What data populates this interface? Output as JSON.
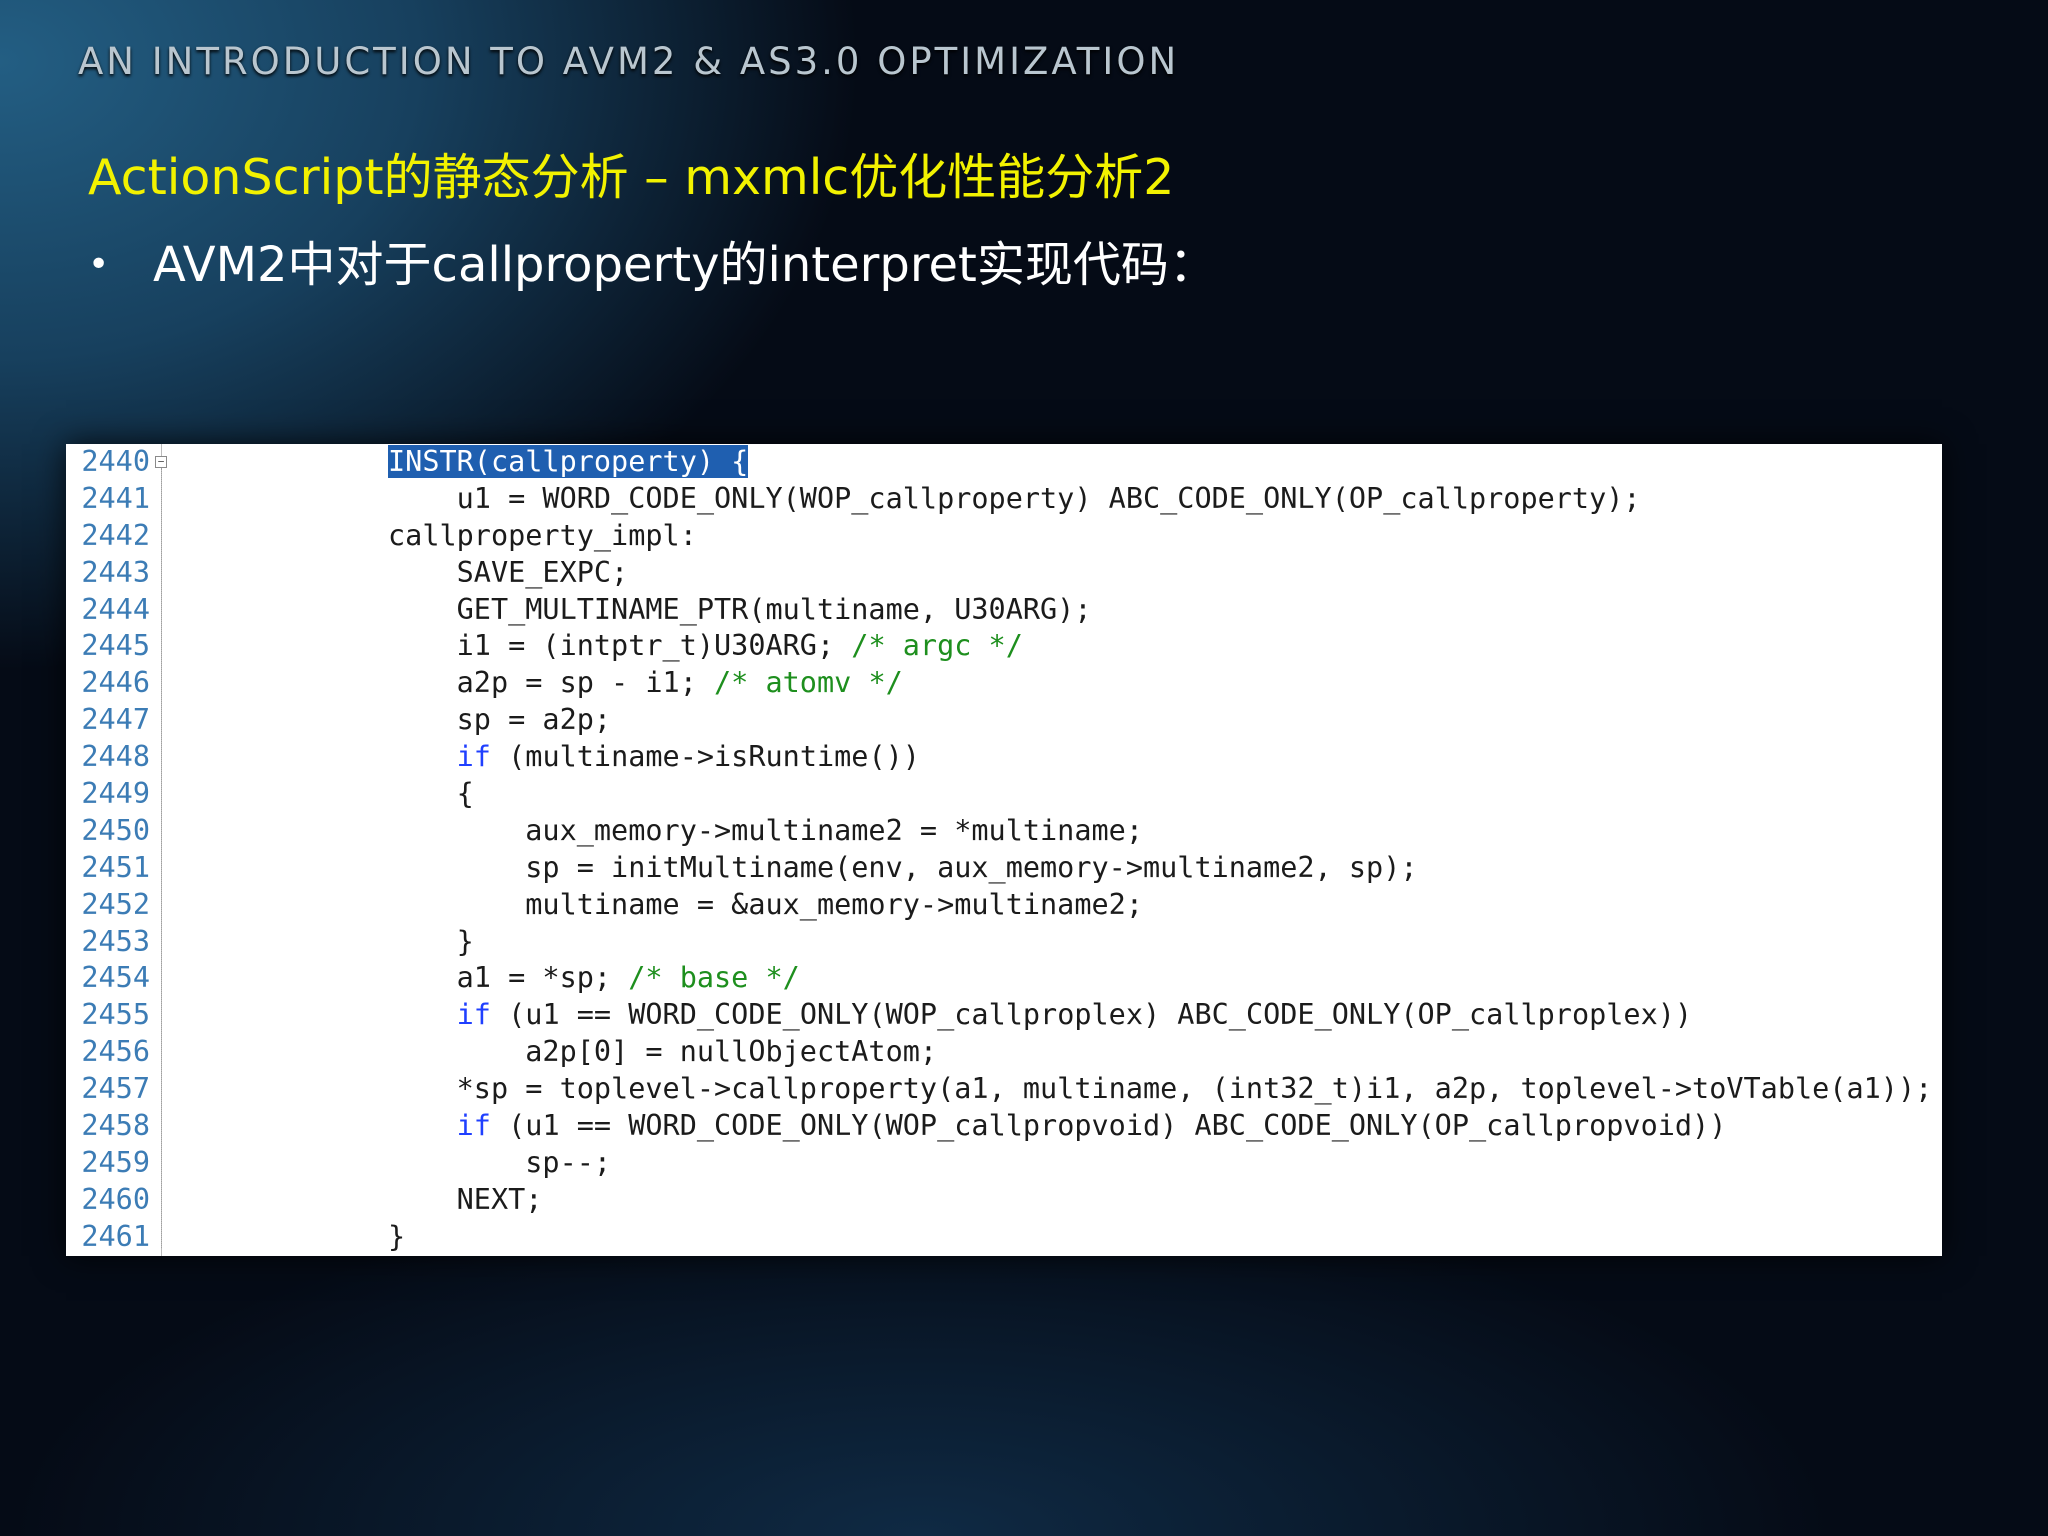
{
  "deck": {
    "title": "AN INTRODUCTION TO AVM2 & AS3.0 OPTIMIZATION"
  },
  "slide": {
    "heading": "ActionScript的静态分析 – mxmlc优化性能分析2",
    "bullet_mark": "•",
    "bullet": "AVM2中对于callproperty的interpret实现代码："
  },
  "code": {
    "fold_glyph": "−",
    "line_numbers": [
      "2440",
      "2441",
      "2442",
      "2443",
      "2444",
      "2445",
      "2446",
      "2447",
      "2448",
      "2449",
      "2450",
      "2451",
      "2452",
      "2453",
      "2454",
      "2455",
      "2456",
      "2457",
      "2458",
      "2459",
      "2460",
      "2461"
    ],
    "lines": [
      [
        {
          "t": "INSTR(callproperty) {",
          "c": "sel"
        }
      ],
      [
        {
          "t": "    u1 = WORD_CODE_ONLY(WOP_callproperty) ABC_CODE_ONLY(OP_callproperty);"
        }
      ],
      [
        {
          "t": "callproperty_impl:"
        }
      ],
      [
        {
          "t": "    SAVE_EXPC;"
        }
      ],
      [
        {
          "t": "    GET_MULTINAME_PTR(multiname, U30ARG);"
        }
      ],
      [
        {
          "t": "    i1 = (intptr_t)U30ARG; "
        },
        {
          "t": "/* argc */",
          "c": "cmt"
        }
      ],
      [
        {
          "t": "    a2p = sp - i1; "
        },
        {
          "t": "/* atomv */",
          "c": "cmt"
        }
      ],
      [
        {
          "t": "    sp = a2p;"
        }
      ],
      [
        {
          "t": "    "
        },
        {
          "t": "if",
          "c": "kw"
        },
        {
          "t": " (multiname->isRuntime())"
        }
      ],
      [
        {
          "t": "    {"
        }
      ],
      [
        {
          "t": "        aux_memory->multiname2 = *multiname;"
        }
      ],
      [
        {
          "t": "        sp = initMultiname(env, aux_memory->multiname2, sp);"
        }
      ],
      [
        {
          "t": "        multiname = &aux_memory->multiname2;"
        }
      ],
      [
        {
          "t": "    }"
        }
      ],
      [
        {
          "t": "    a1 = *sp; "
        },
        {
          "t": "/* base */",
          "c": "cmt"
        }
      ],
      [
        {
          "t": "    "
        },
        {
          "t": "if",
          "c": "kw"
        },
        {
          "t": " (u1 == WORD_CODE_ONLY(WOP_callproplex) ABC_CODE_ONLY(OP_callproplex))"
        }
      ],
      [
        {
          "t": "        a2p[0] = nullObjectAtom;"
        }
      ],
      [
        {
          "t": "    *sp = toplevel->callproperty(a1, multiname, (int32_t)i1, a2p, toplevel->toVTable(a1));"
        }
      ],
      [
        {
          "t": "    "
        },
        {
          "t": "if",
          "c": "kw"
        },
        {
          "t": " (u1 == WORD_CODE_ONLY(WOP_callpropvoid) ABC_CODE_ONLY(OP_callpropvoid))"
        }
      ],
      [
        {
          "t": "        sp--;"
        }
      ],
      [
        {
          "t": "    NEXT;"
        }
      ],
      [
        {
          "t": "}"
        }
      ]
    ]
  },
  "colors": {
    "heading": "#f2f200",
    "line_number": "#3c7cb5",
    "keyword": "#1f3fff",
    "comment": "#1e8f1e",
    "selection": "#1f5fb0"
  }
}
